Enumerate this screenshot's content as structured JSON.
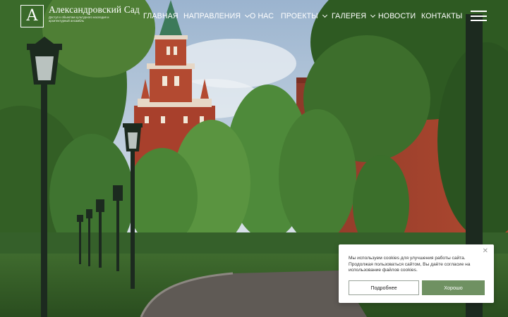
{
  "site": {
    "title": "Александровский Сад",
    "subtitle": "Доступ к объектам культурного наследия и архитектурный ансамбль"
  },
  "nav": {
    "items": [
      {
        "label": "ГЛАВНАЯ",
        "dropdown": false
      },
      {
        "label": "НАПРАВЛЕНИЯ",
        "dropdown": true
      },
      {
        "label": "О НАС",
        "dropdown": false
      },
      {
        "label": "ПРОЕКТЫ",
        "dropdown": true
      },
      {
        "label": "ГАЛЕРЕЯ",
        "dropdown": true
      },
      {
        "label": "НОВОСТИ",
        "dropdown": false
      },
      {
        "label": "КОНТАКТЫ",
        "dropdown": false
      }
    ],
    "menu_icon": "burger-menu-icon"
  },
  "hero": {
    "image": "Kremlin tower and park alley with lamp posts"
  },
  "cookie": {
    "text": "Мы используем cookies для улучшения работы сайта. Продолжая пользоваться сайтом, Вы даёте согласие на использование файлов cookies.",
    "more_label": "Подробнее",
    "ok_label": "Хорошо",
    "close_icon": "close-icon"
  },
  "colors": {
    "accent": "#6f9162",
    "banner_bg": "#ffffff",
    "header_text": "#ffffff"
  }
}
